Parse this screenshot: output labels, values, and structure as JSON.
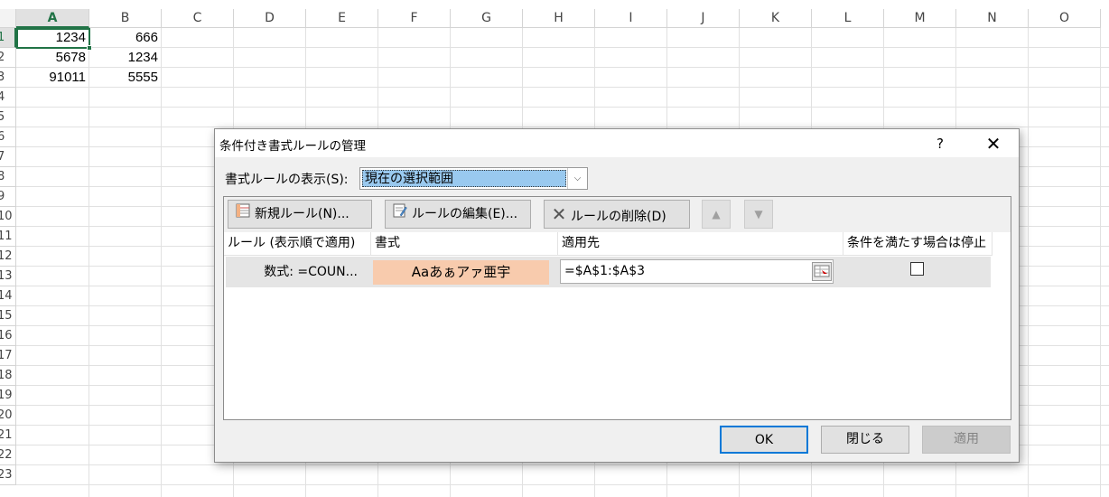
{
  "sheet": {
    "columns": [
      "A",
      "B",
      "C",
      "D",
      "E",
      "F",
      "G",
      "H",
      "I",
      "J",
      "K",
      "L",
      "M",
      "N",
      "O"
    ],
    "rows": [
      "1",
      "2",
      "3",
      "4",
      "5",
      "6",
      "7",
      "8",
      "9",
      "10",
      "11",
      "12",
      "13",
      "14",
      "15",
      "16",
      "17",
      "18",
      "19",
      "20",
      "21",
      "22",
      "23"
    ],
    "cells": {
      "A1": "1234",
      "B1": "666",
      "A2": "5678",
      "B2": "1234",
      "A3": "91011",
      "B3": "5555"
    },
    "accent_color": "#217346"
  },
  "dialog": {
    "title": "条件付き書式ルールの管理",
    "help_label": "?",
    "close_label": "✕",
    "show_rules_label": "書式ルールの表示(S):",
    "show_rules_value": "現在の選択範囲",
    "toolbar": {
      "new_rule": "新規ルール(N)...",
      "edit_rule": "ルールの編集(E)...",
      "delete_rule": "ルールの削除(D)",
      "move_up": "▲",
      "move_down": "▼"
    },
    "table": {
      "headers": [
        "ルール (表示順で適用)",
        "書式",
        "適用先",
        "条件を満たす場合は停止"
      ],
      "rows": [
        {
          "rule": "数式: =COUN...",
          "format_preview": "Aaあぁアァ亜宇",
          "applies_to": "=$A$1:$A$3",
          "stop_if_true": false
        }
      ]
    },
    "buttons": {
      "ok": "OK",
      "close": "閉じる",
      "apply": "適用"
    },
    "colors": {
      "format_preview_bg": "#f8cbad",
      "selection_highlight": "#99c9ef",
      "ok_border": "#0078d7"
    }
  }
}
